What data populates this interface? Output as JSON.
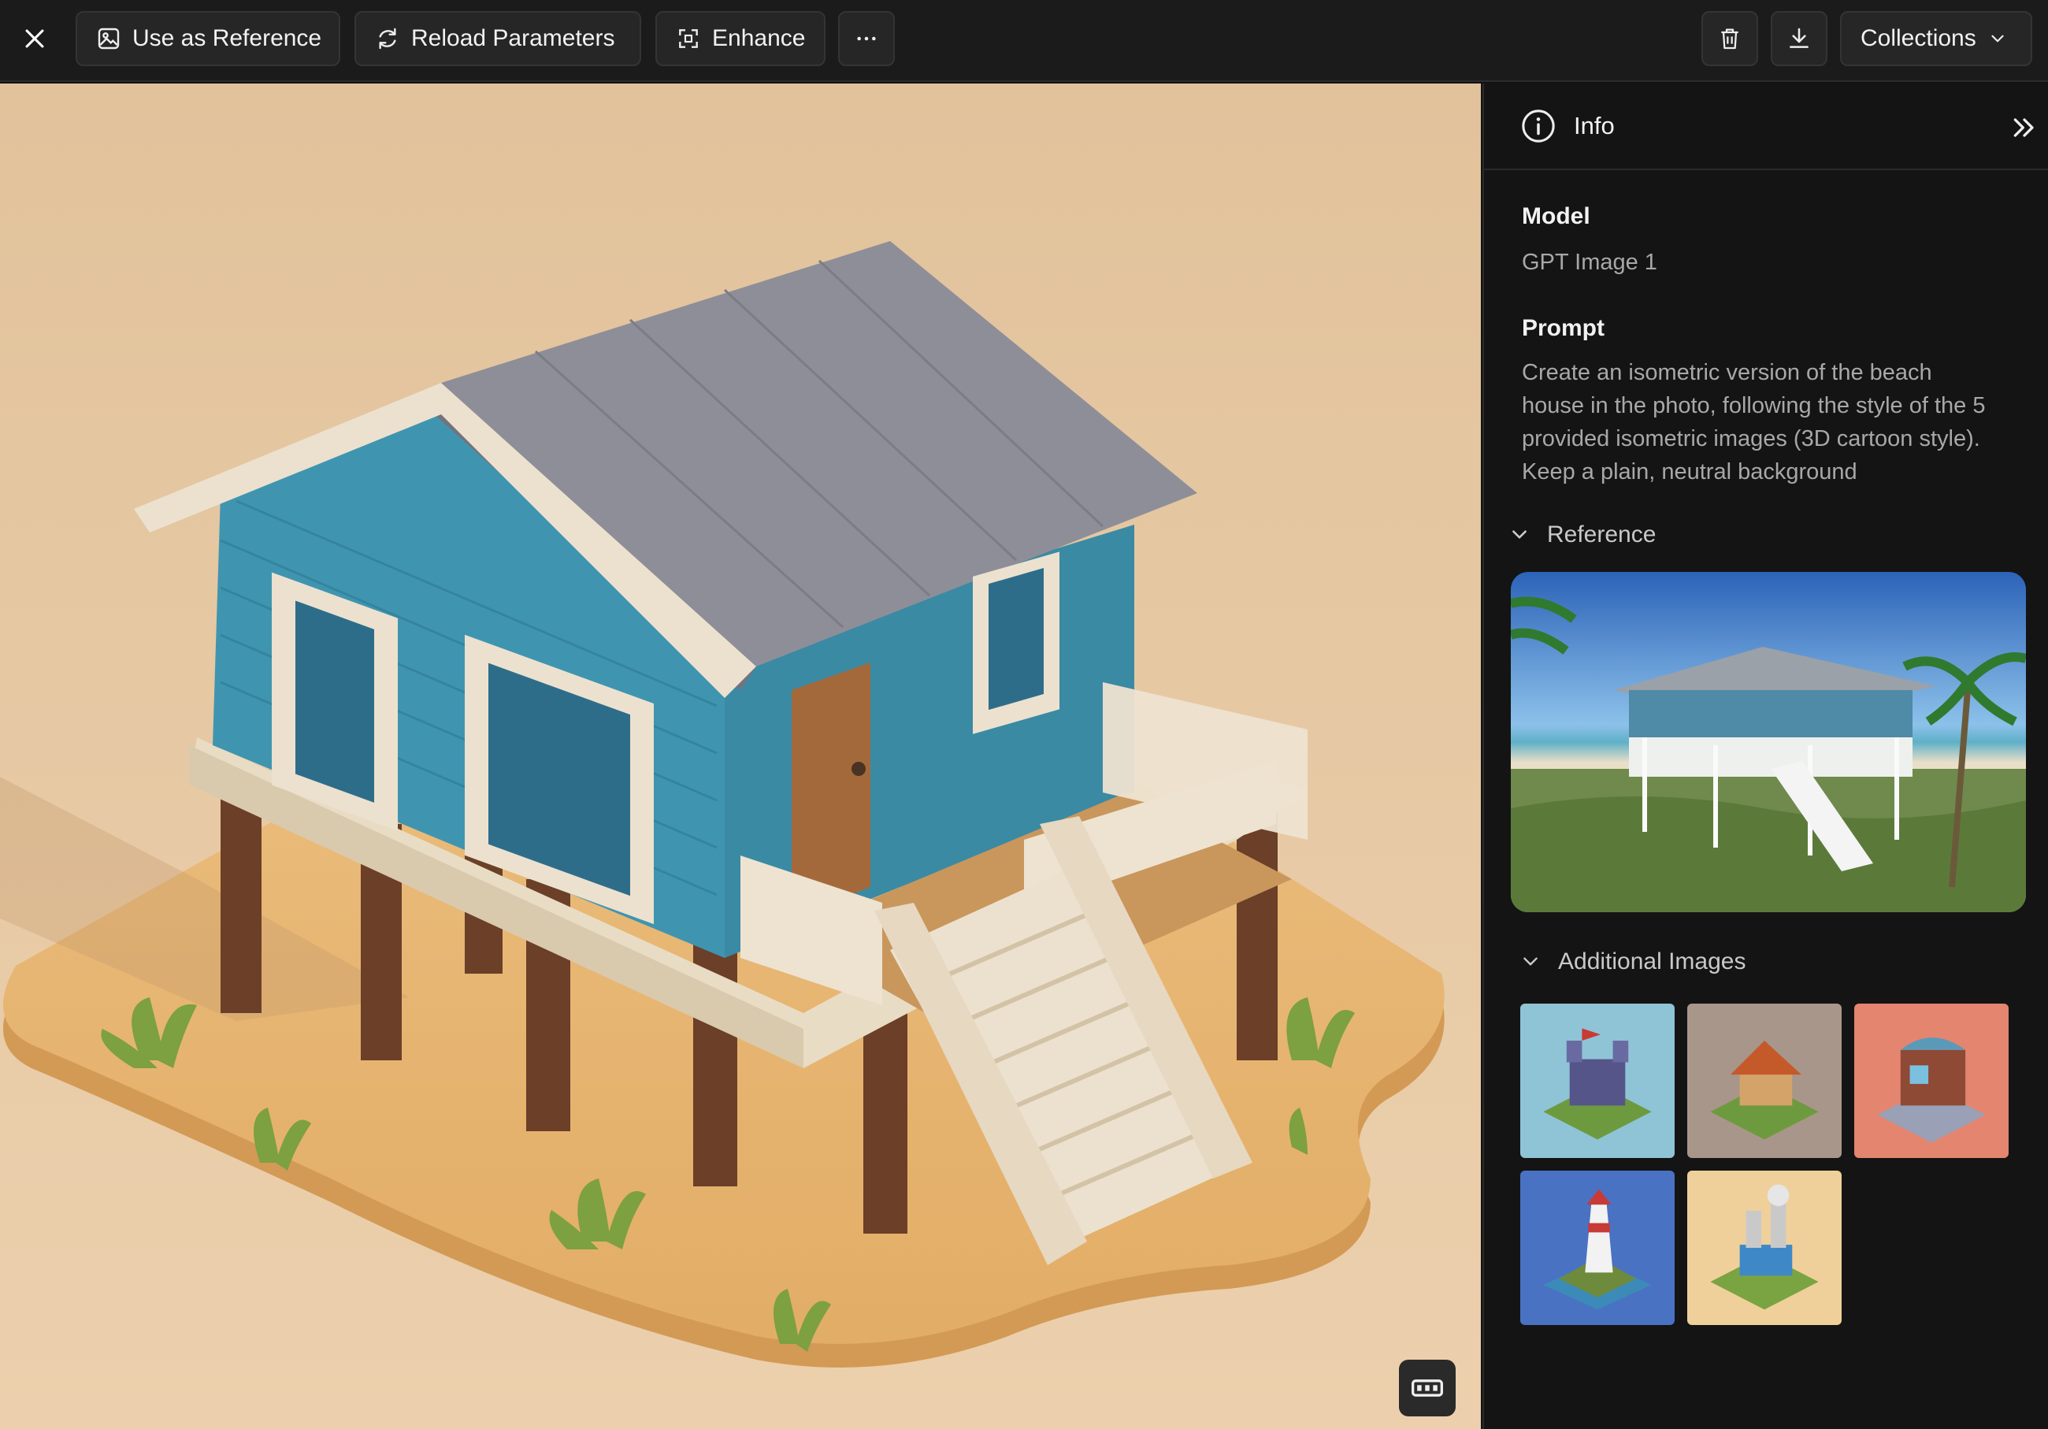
{
  "toolbar": {
    "close_icon": "close-icon",
    "use_as_reference": "Use as Reference",
    "reload_parameters": "Reload Parameters",
    "enhance": "Enhance",
    "more_icon": "more-icon",
    "delete_icon": "trash-icon",
    "download_icon": "download-icon",
    "collections": "Collections"
  },
  "panel": {
    "title": "Info",
    "model_label": "Model",
    "model_value": "GPT Image 1",
    "prompt_label": "Prompt",
    "prompt_lines": [
      "Create an isometric version of the beach",
      "house in the photo, following the style of the 5",
      "provided isometric images (3D cartoon style).",
      "Keep a plain, neutral background"
    ],
    "reference_label": "Reference",
    "additional_label": "Additional Images",
    "thumbnails": [
      "castle",
      "cottage",
      "shop",
      "lighthouse",
      "factory"
    ]
  },
  "colors": {
    "canvas_bg": "#e3c6a1",
    "sand": "#e6b877",
    "house_blue": "#3f95b0",
    "roof": "#8d8d98",
    "trim": "#ece1cf"
  }
}
